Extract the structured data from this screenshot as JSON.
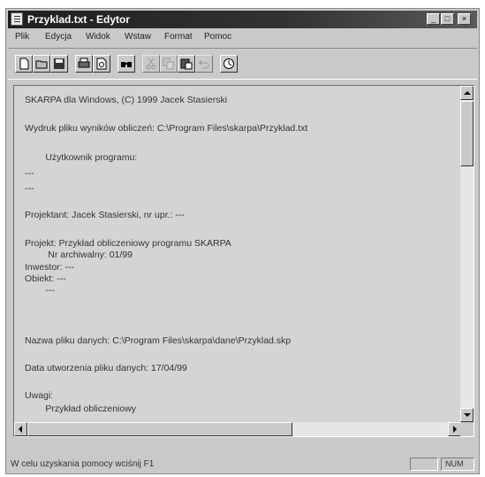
{
  "window": {
    "title": "Przyklad.txt - Edytor"
  },
  "title_buttons": {
    "minimize": "_",
    "maximize": "□",
    "close": "×"
  },
  "menu": [
    "Plik",
    "Edycja",
    "Widok",
    "Wstaw",
    "Format",
    "Pomoc"
  ],
  "toolbar": {
    "tools": [
      {
        "name": "new-file-icon",
        "enabled": true
      },
      {
        "name": "open-file-icon",
        "enabled": true
      },
      {
        "name": "save-icon",
        "enabled": true
      },
      {
        "name": "print-icon",
        "enabled": true
      },
      {
        "name": "print-preview-icon",
        "enabled": true
      },
      {
        "name": "find-icon",
        "enabled": true
      },
      {
        "name": "cut-icon",
        "enabled": false
      },
      {
        "name": "copy-icon",
        "enabled": false
      },
      {
        "name": "paste-icon",
        "enabled": true
      },
      {
        "name": "undo-icon",
        "enabled": false
      },
      {
        "name": "clock-icon",
        "enabled": true
      }
    ]
  },
  "document": {
    "lines": [
      "SKARPA dla Windows, (C) 1999 Jacek Stasierski",
      "Wydruk pliku wyników obliczeń: C:\\Program Files\\skarpa\\Przyklad.txt",
      "        Użytkownik programu:",
      "---",
      "---",
      "Projektant: Jacek Stasierski, nr upr.: ---",
      "Projekt: Przykład obliczeniowy programu SKARPA",
      "         Nr archiwalny: 01/99",
      "Inwestor: ---",
      "Obiekt: ---",
      "        ---",
      "Nazwa pliku danych: C:\\Program Files\\skarpa\\dane\\Przyklad.skp",
      "Data utworzenia pliku danych: 17/04/99",
      "Uwagi:",
      "        Przykład obliczeniowy"
    ]
  },
  "status": {
    "message": "W celu uzyskania pomocy wciśnij F1",
    "panel_empty": "",
    "num": "NUM"
  }
}
